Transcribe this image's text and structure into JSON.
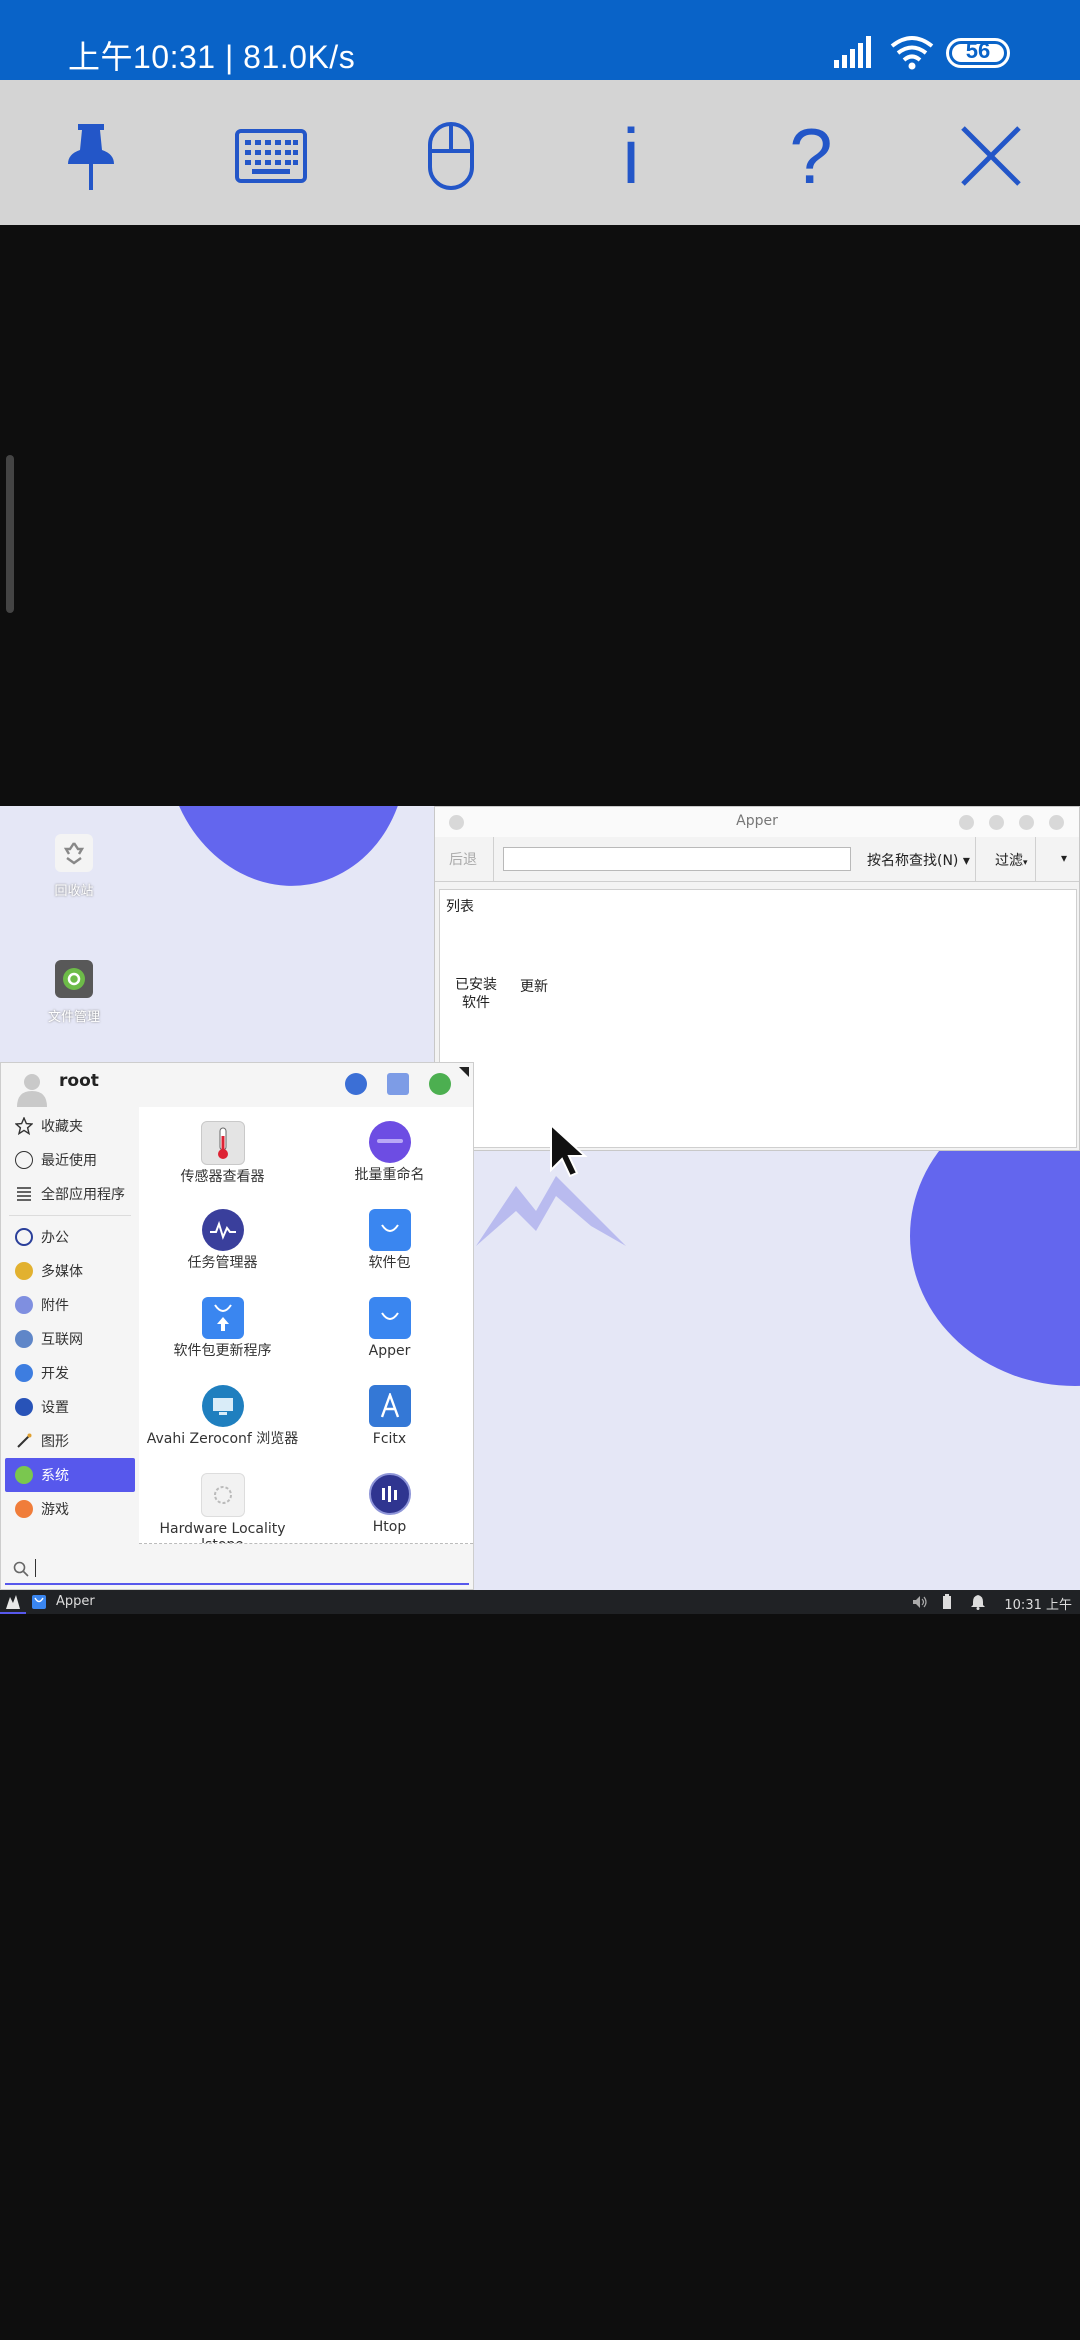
{
  "statusbar": {
    "time_speed": "上午10:31 | 81.0K/s",
    "battery": "56"
  },
  "toolbar": {
    "info": "i",
    "help": "?"
  },
  "desktop": {
    "icons": [
      {
        "label": "回收站"
      },
      {
        "label": "文件管理"
      }
    ]
  },
  "apper": {
    "title": "Apper",
    "back": "后退",
    "find_by": "按名称查找(N)",
    "filter": "过滤",
    "list_header": "列表",
    "tab_installed": "已安装\n软件",
    "tab_updates": "更新"
  },
  "menu": {
    "username": "root",
    "categories": [
      {
        "label": "收藏夹",
        "icon": "star-icon"
      },
      {
        "label": "最近使用",
        "icon": "clock-icon"
      },
      {
        "label": "全部应用程序",
        "icon": "list-icon"
      },
      {
        "label": "办公",
        "icon": "office-icon"
      },
      {
        "label": "多媒体",
        "icon": "multimedia-icon"
      },
      {
        "label": "附件",
        "icon": "accessories-icon"
      },
      {
        "label": "互联网",
        "icon": "internet-icon"
      },
      {
        "label": "开发",
        "icon": "development-icon"
      },
      {
        "label": "设置",
        "icon": "settings-icon"
      },
      {
        "label": "图形",
        "icon": "graphics-icon"
      },
      {
        "label": "系统",
        "icon": "system-icon",
        "selected": true
      },
      {
        "label": "游戏",
        "icon": "games-icon"
      }
    ],
    "apps": [
      {
        "label": "传感器查看器",
        "icon": "thermometer-icon"
      },
      {
        "label": "批量重命名",
        "icon": "rename-icon"
      },
      {
        "label": "任务管理器",
        "icon": "task-manager-icon"
      },
      {
        "label": "软件包",
        "icon": "package-bag-icon"
      },
      {
        "label": "软件包更新程序",
        "icon": "package-update-icon"
      },
      {
        "label": "Apper",
        "icon": "apper-bag-icon"
      },
      {
        "label": "Avahi Zeroconf 浏览器",
        "icon": "avahi-icon"
      },
      {
        "label": "Fcitx",
        "icon": "fcitx-icon"
      },
      {
        "label": "Hardware Locality lstopo",
        "icon": "hwloc-icon"
      },
      {
        "label": "Htop",
        "icon": "htop-icon"
      }
    ]
  },
  "taskbar": {
    "task": "Apper",
    "clock": "10:31 上午"
  },
  "colors": {
    "status_blue": "#0963c8",
    "toolbar_icon_blue": "#2356c8",
    "accent_purple": "#5758ec",
    "blob_purple": "#6366ee"
  }
}
